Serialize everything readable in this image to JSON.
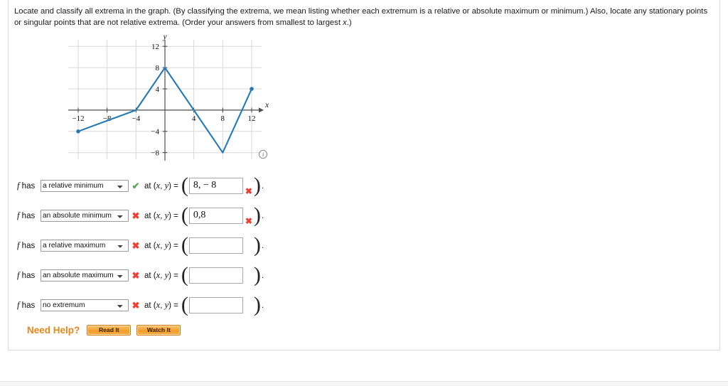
{
  "prompt": {
    "line1": "Locate and classify all extrema in the graph. (By classifying the extrema, we mean listing whether each extremum is a relative or absolute maximum or minimum.) Also, locate any stationary points or",
    "line2_a": "singular points that are not relative extrema. (Order your answers from smallest to largest ",
    "line2_x": "x",
    "line2_b": ".)"
  },
  "graph": {
    "info_icon": "info-icon"
  },
  "chart_data": {
    "type": "line",
    "title": "",
    "xlabel": "x",
    "ylabel": "y",
    "xlim": [
      -14,
      14
    ],
    "ylim": [
      -9.5,
      13.5
    ],
    "xticks": [
      -12,
      -8,
      -4,
      4,
      8,
      12
    ],
    "xtick_labels": [
      "−12",
      "−8",
      "−4",
      "4",
      "8",
      "12"
    ],
    "yticks": [
      12,
      8,
      4,
      -4,
      -8
    ],
    "ytick_labels": [
      "12",
      "8",
      "4",
      "−4",
      "−8"
    ],
    "grid": true,
    "grid_x": [
      -12,
      -8,
      -4,
      0,
      4,
      8,
      12
    ],
    "grid_y": [
      12,
      8,
      4,
      0,
      -4,
      -8
    ],
    "legend": "none",
    "series": [
      {
        "name": "f",
        "color": "#1f77b4",
        "x": [
          -12,
          -4,
          0,
          8,
          12
        ],
        "y": [
          -4,
          0,
          8,
          -8,
          4
        ],
        "endpoint_markers": [
          [
            -12,
            -4
          ],
          [
            12,
            4
          ]
        ]
      }
    ]
  },
  "rows": [
    {
      "prefix": "f has",
      "classifier": "a relative minimum",
      "classifier_mark": "correct",
      "at_label": "at (x, y) =",
      "value": "8, − 8",
      "value_mark": "wrong"
    },
    {
      "prefix": "f has",
      "classifier": "an absolute minimum",
      "classifier_mark": "wrong",
      "at_label": "at (x, y) =",
      "value": "0,8",
      "value_mark": "wrong"
    },
    {
      "prefix": "f has",
      "classifier": "a relative maximum",
      "classifier_mark": "wrong",
      "at_label": "at (x, y) =",
      "value": "",
      "value_mark": "none"
    },
    {
      "prefix": "f has",
      "classifier": "an absolute maximum",
      "classifier_mark": "wrong",
      "at_label": "at (x, y) =",
      "value": "",
      "value_mark": "none"
    },
    {
      "prefix": "f has",
      "classifier": "no extremum",
      "classifier_mark": "wrong",
      "at_label": "at (x, y) =",
      "value": "",
      "value_mark": "none"
    }
  ],
  "classifier_options": [
    "a relative minimum",
    "an absolute minimum",
    "a relative maximum",
    "an absolute maximum",
    "no extremum"
  ],
  "marks": {
    "correct_glyph": "✔",
    "wrong_glyph": "✖",
    "correct_color": "#55a855",
    "wrong_color": "#ef3f32"
  },
  "need_help": {
    "label": "Need Help?",
    "read_it": "Read It",
    "watch_it": "Watch It"
  }
}
